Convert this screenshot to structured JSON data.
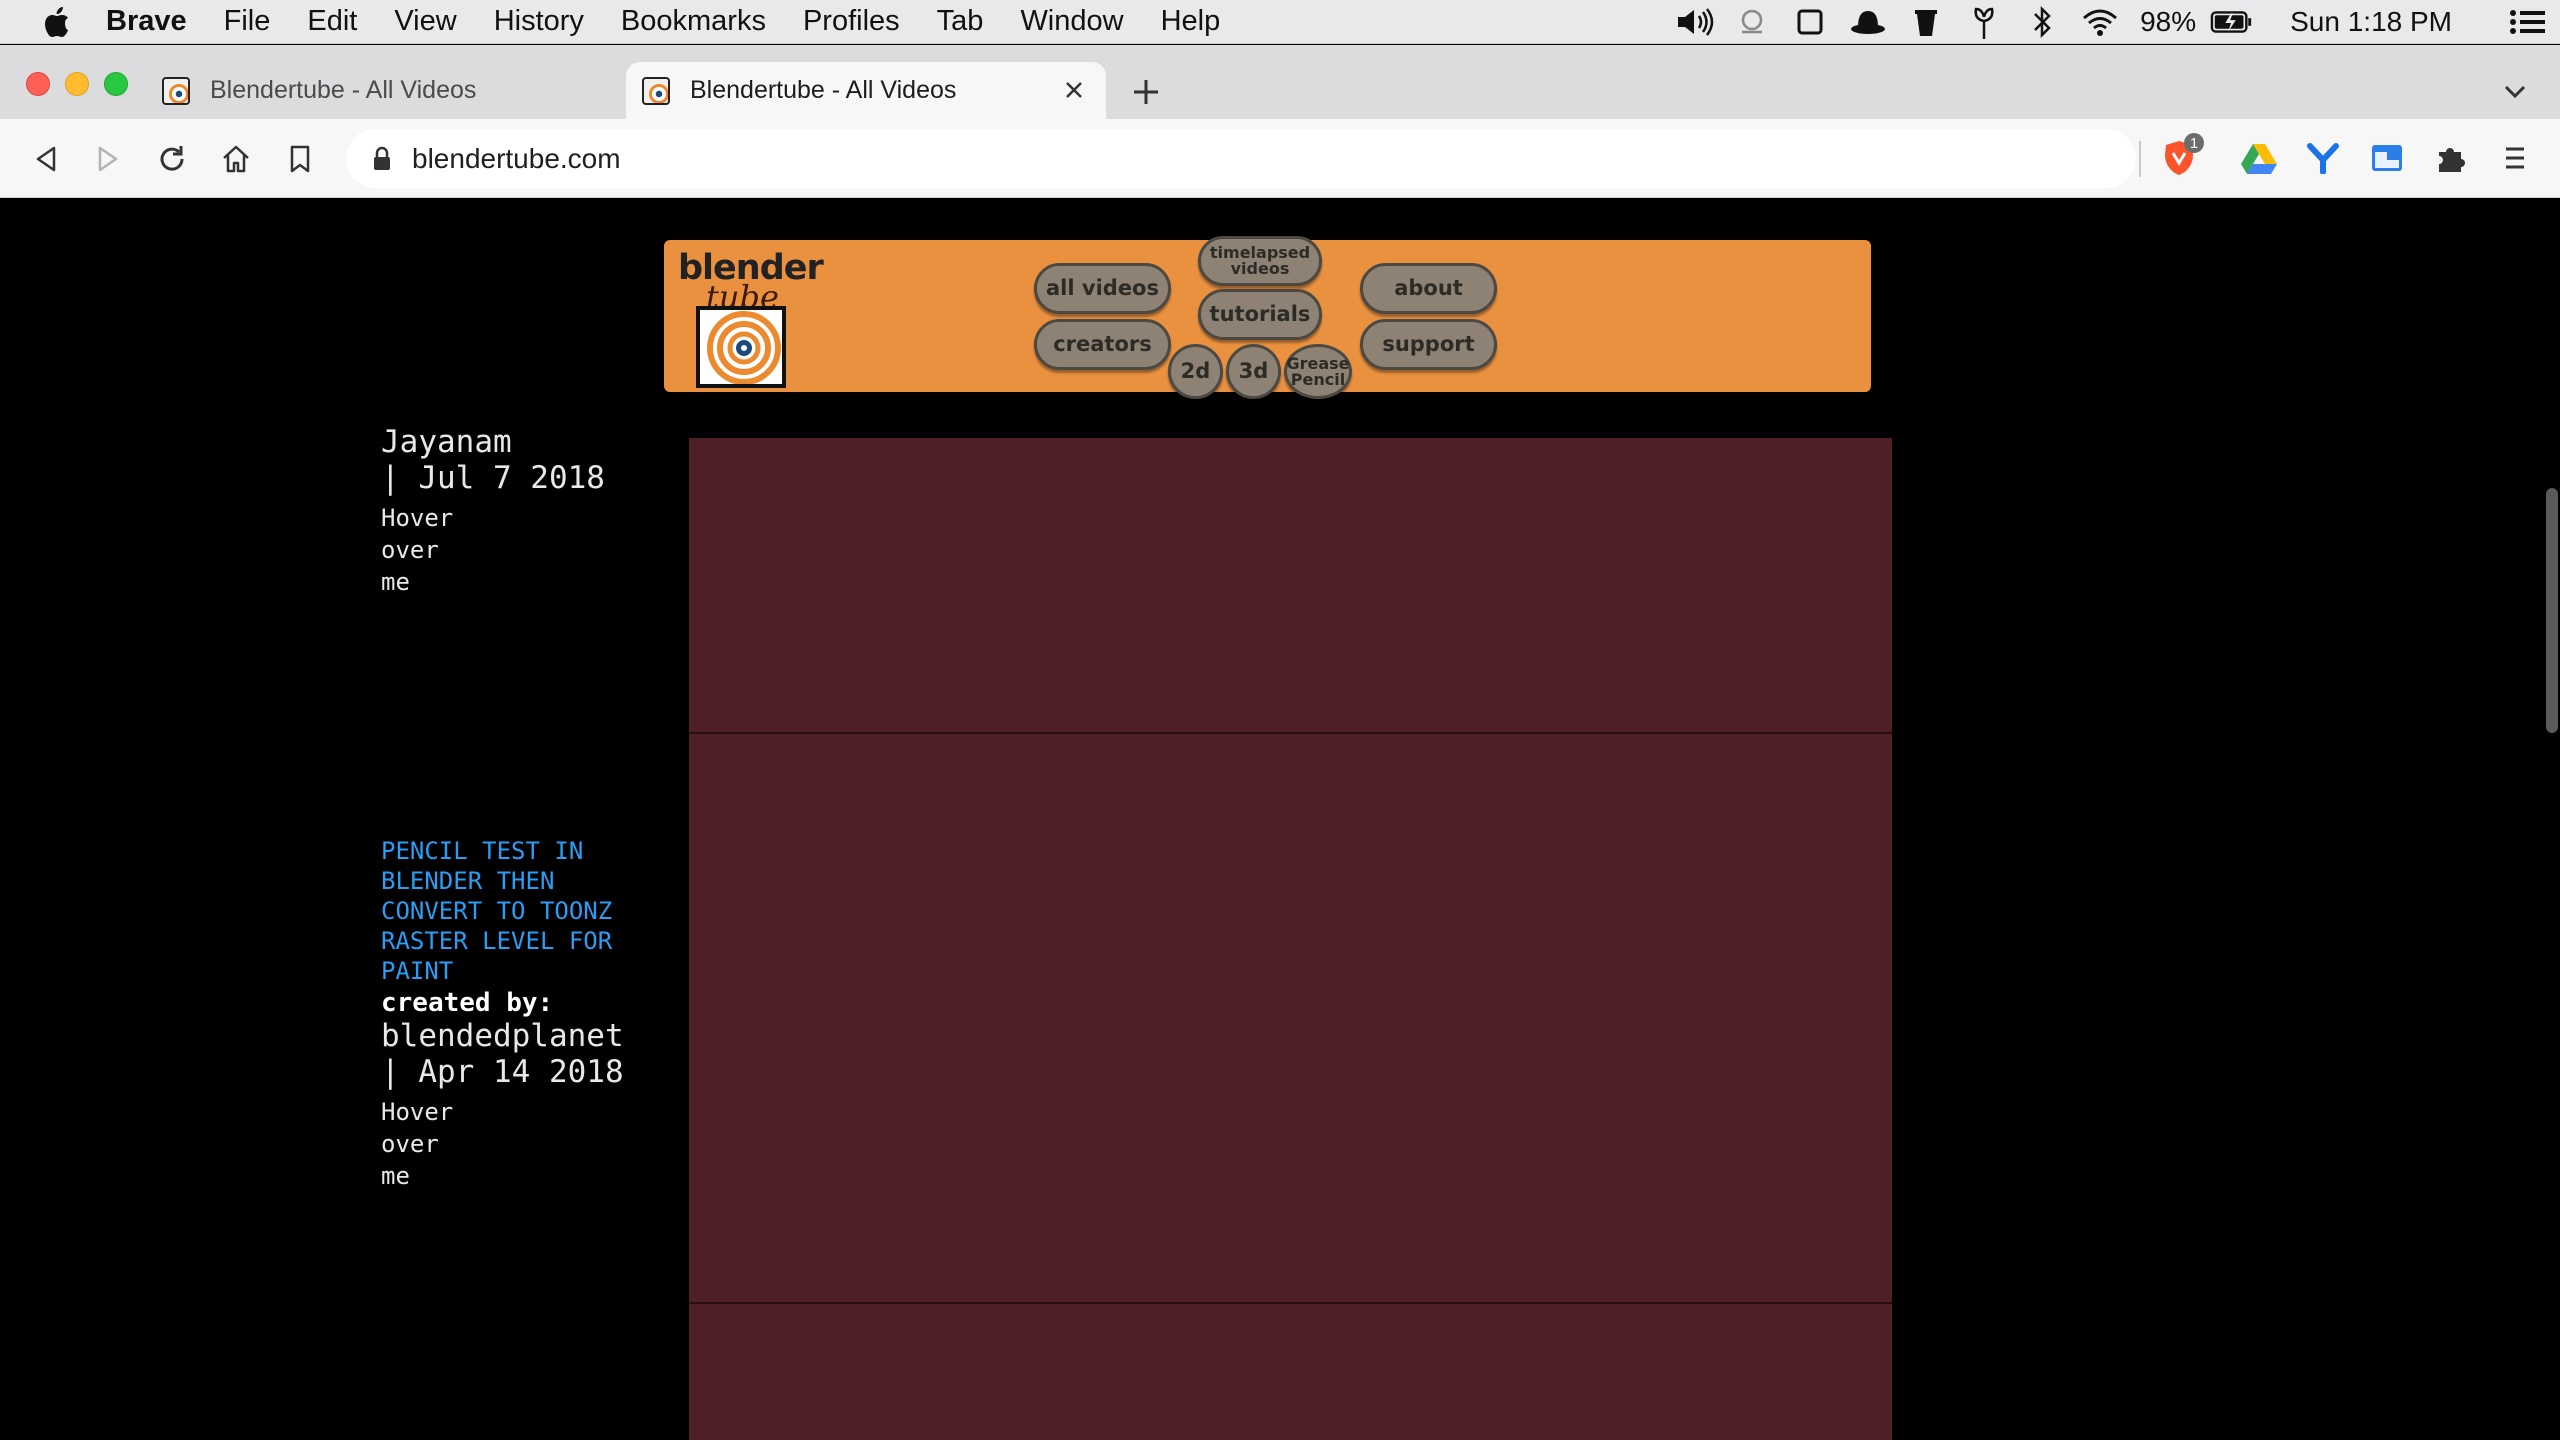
{
  "menubar": {
    "app_name": "Brave",
    "items": [
      "File",
      "Edit",
      "View",
      "History",
      "Bookmarks",
      "Profiles",
      "Tab",
      "Window",
      "Help"
    ],
    "battery_percent": "98%",
    "clock": "Sun 1:18 PM"
  },
  "tabs": [
    {
      "title": "Blendertube - All Videos",
      "active": false
    },
    {
      "title": "Blendertube - All Videos",
      "active": true
    }
  ],
  "toolbar": {
    "url": "blendertube.com",
    "brave_shield_count": "1"
  },
  "site": {
    "logo_word_1": "blender",
    "logo_word_2": "tube",
    "nav": {
      "all_videos": "all videos",
      "creators": "creators",
      "timelapsed_videos": "timelapsed videos",
      "tutorials": "tutorials",
      "about": "about",
      "support": "support",
      "filter_2d": "2d",
      "filter_3d": "3d",
      "filter_grease_pencil": "Grease Pencil"
    }
  },
  "videos": [
    {
      "author": "Jayanam",
      "date": "| Jul 7 2018",
      "hover_lines": [
        "Hover",
        "over",
        "me"
      ]
    },
    {
      "title": "PENCIL TEST IN BLENDER THEN CONVERT TO TOONZ RASTER LEVEL FOR PAINT",
      "created_label": "created by:",
      "author": "blendedplanet",
      "date": "| Apr 14 2018",
      "hover_lines": [
        "Hover",
        "over",
        "me"
      ]
    }
  ],
  "colors": {
    "header_orange": "#ea9140",
    "video_placeholder": "#4e1f24",
    "title_link": "#2a9df4"
  }
}
